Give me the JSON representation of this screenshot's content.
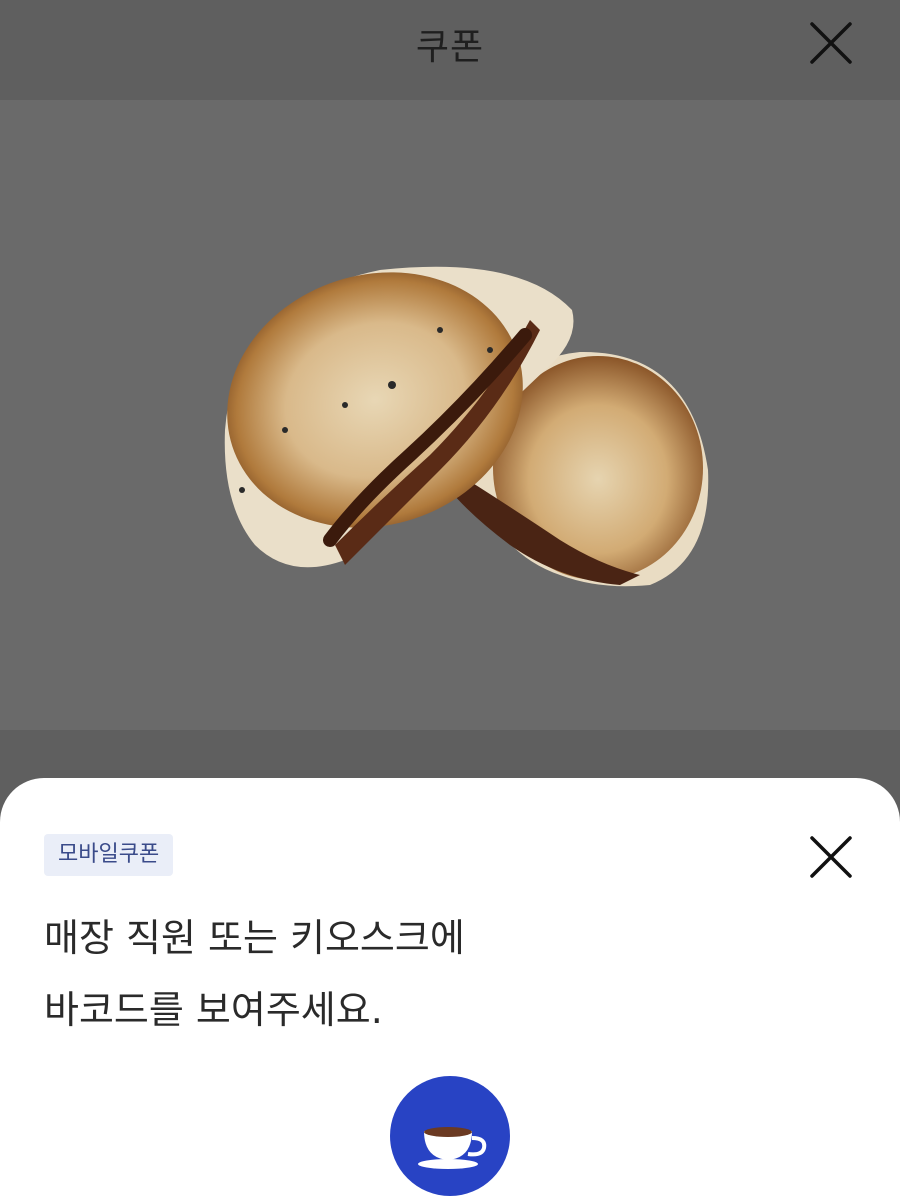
{
  "header": {
    "title": "쿠폰",
    "close_icon": "close-icon"
  },
  "product_image": {
    "icon": "hotteok-photo"
  },
  "sheet": {
    "badge": "모바일쿠폰",
    "close_icon": "close-icon",
    "message_line1": "매장 직원 또는 키오스크에",
    "message_line2": "바코드를 보여주세요.",
    "brand_icon": "coffee-cup-icon",
    "brand_color": "#2843c4"
  }
}
